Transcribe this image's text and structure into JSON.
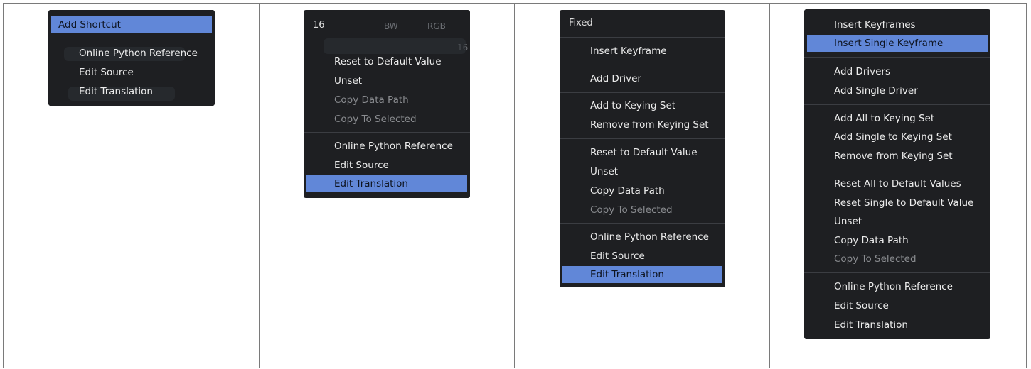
{
  "panel1": {
    "items": [
      {
        "label": "Add Shortcut"
      },
      {
        "label": "Online Python Reference"
      },
      {
        "label": "Edit Source"
      },
      {
        "label": "Edit Translation"
      }
    ]
  },
  "panel2": {
    "header": {
      "value": "16",
      "bw": "BW",
      "rgb": "RGB",
      "right_value": "16"
    },
    "items": [
      {
        "label": "Reset to Default Value"
      },
      {
        "label": "Unset"
      },
      {
        "label": "Copy Data Path"
      },
      {
        "label": "Copy To Selected"
      },
      {
        "label": "Online Python Reference"
      },
      {
        "label": "Edit Source"
      },
      {
        "label": "Edit Translation"
      }
    ]
  },
  "panel3": {
    "header": {
      "title": "Fixed"
    },
    "items": [
      {
        "label": "Insert Keyframe"
      },
      {
        "label": "Add Driver"
      },
      {
        "label": "Add to Keying Set"
      },
      {
        "label": "Remove from Keying Set"
      },
      {
        "label": "Reset to Default Value"
      },
      {
        "label": "Unset"
      },
      {
        "label": "Copy Data Path"
      },
      {
        "label": "Copy To Selected"
      },
      {
        "label": "Online Python Reference"
      },
      {
        "label": "Edit Source"
      },
      {
        "label": "Edit Translation"
      }
    ]
  },
  "panel4": {
    "items": [
      {
        "label": "Insert Keyframes"
      },
      {
        "label": "Insert Single Keyframe"
      },
      {
        "label": "Add Drivers"
      },
      {
        "label": "Add Single Driver"
      },
      {
        "label": "Add All to Keying Set"
      },
      {
        "label": "Add Single to Keying Set"
      },
      {
        "label": "Remove from Keying Set"
      },
      {
        "label": "Reset All to Default Values"
      },
      {
        "label": "Reset Single to Default Value"
      },
      {
        "label": "Unset"
      },
      {
        "label": "Copy Data Path"
      },
      {
        "label": "Copy To Selected"
      },
      {
        "label": "Online Python Reference"
      },
      {
        "label": "Edit Source"
      },
      {
        "label": "Edit Translation"
      }
    ]
  }
}
